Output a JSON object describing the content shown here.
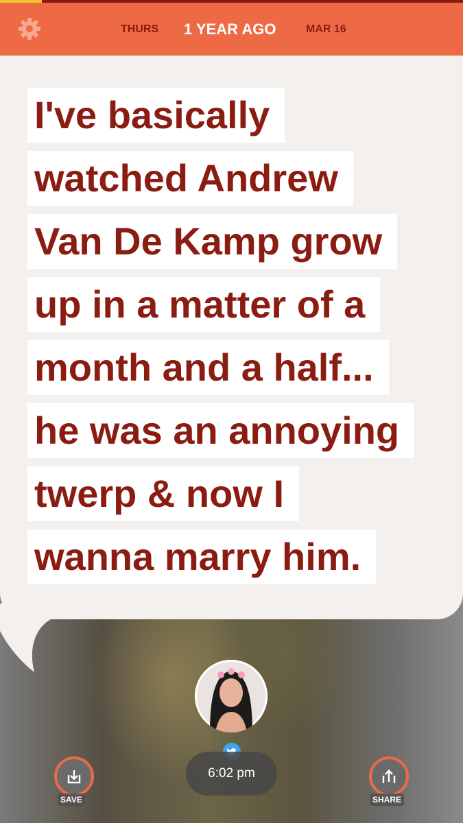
{
  "progress": 0.09,
  "header": {
    "day": "THURS",
    "title": "1 YEAR AGO",
    "date": "MAR 16"
  },
  "post": {
    "lines": [
      "I've basically",
      "watched Andrew",
      "Van De Kamp grow",
      "up in a matter of a",
      "month and a half...",
      "he was an annoying",
      "twerp & now I",
      "wanna marry him."
    ],
    "time": "6:02 pm",
    "source_icon": "twitter-icon"
  },
  "actions": {
    "save_label": "SAVE",
    "share_label": "SHARE"
  },
  "colors": {
    "accent": "#ed6a45",
    "text_red": "#8a1c12",
    "bubble": "#f3f0ed"
  }
}
